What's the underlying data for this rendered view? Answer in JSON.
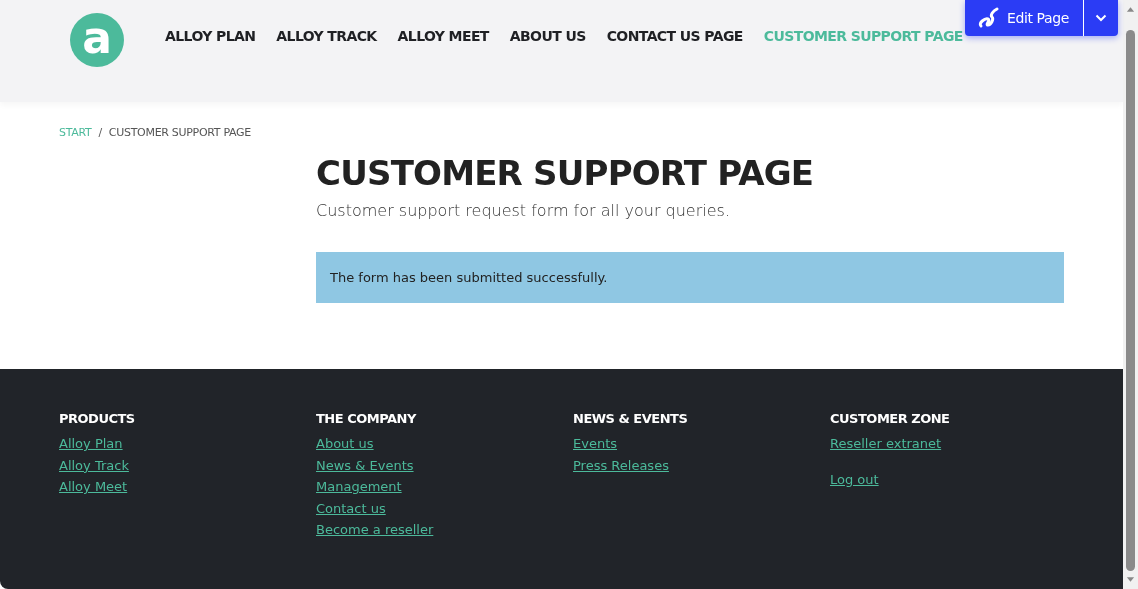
{
  "logo": {
    "letter": "a"
  },
  "nav": [
    {
      "label": "ALLOY PLAN",
      "selected": false
    },
    {
      "label": "ALLOY TRACK",
      "selected": false
    },
    {
      "label": "ALLOY MEET",
      "selected": false
    },
    {
      "label": "ABOUT US",
      "selected": false
    },
    {
      "label": "CONTACT US PAGE",
      "selected": false
    },
    {
      "label": "CUSTOMER SUPPORT PAGE",
      "selected": true
    }
  ],
  "edit_button": {
    "label": "Edit Page"
  },
  "breadcrumb": [
    {
      "label": "START",
      "link": true
    },
    {
      "label": "CUSTOMER SUPPORT PAGE",
      "link": false
    }
  ],
  "breadcrumb_separator": "/",
  "page": {
    "title": "CUSTOMER SUPPORT PAGE",
    "intro": "Customer support request form for all your queries.",
    "alert": "The form has been submitted successfully."
  },
  "footer": [
    {
      "heading": "PRODUCTS",
      "groups": [
        [
          "Alloy Plan",
          "Alloy Track",
          "Alloy Meet"
        ]
      ]
    },
    {
      "heading": "THE COMPANY",
      "groups": [
        [
          "About us",
          "News & Events",
          "Management",
          "Contact us",
          "Become a reseller"
        ]
      ]
    },
    {
      "heading": "NEWS & EVENTS",
      "groups": [
        [
          "Events",
          "Press Releases"
        ]
      ]
    },
    {
      "heading": "CUSTOMER ZONE",
      "groups": [
        [
          "Reseller extranet"
        ],
        [
          "Log out"
        ]
      ]
    }
  ]
}
